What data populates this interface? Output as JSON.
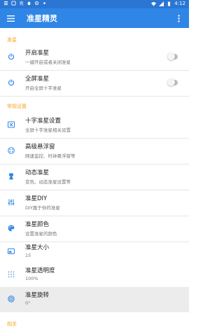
{
  "statusbar": {
    "time": "4:12"
  },
  "appbar": {
    "title": "准星精灵"
  },
  "colors": {
    "primary": "#2f86e6",
    "statusbar": "#2a76d2",
    "section": "#f5a623",
    "icon": "#2f86e6"
  },
  "sections": {
    "crosshair": "准星",
    "general": "常规设置",
    "related": "相关"
  },
  "rows": [
    {
      "label": "开启准星",
      "sub": "一键开启或者关闭准星",
      "icon": "power-icon",
      "toggle": true
    },
    {
      "label": "全屏准星",
      "sub": "开启全屏十字准星",
      "icon": "power-icon",
      "toggle": true
    },
    {
      "label": "十字准星设置",
      "sub": "全屏十字准星相关设置",
      "icon": "crosshair-box-icon"
    },
    {
      "label": "高级悬浮窗",
      "sub": "网速监控、时钟悬浮窗等",
      "icon": "dots-circle-icon"
    },
    {
      "label": "动态准星",
      "sub": "变色、动态准星设置等",
      "icon": "gamepad-icon"
    },
    {
      "label": "准星DIY",
      "sub": "DIY属于你的准星",
      "icon": "equalizer-icon"
    },
    {
      "label": "准星颜色",
      "sub": "设置准星的颜色",
      "icon": "palette-icon"
    },
    {
      "label": "准星大小",
      "sub": "15",
      "icon": "size-icon"
    },
    {
      "label": "准星透明度",
      "sub": "100%",
      "icon": "dotgrid-icon"
    },
    {
      "label": "准星旋转",
      "sub": "0°",
      "icon": "rotate-icon"
    }
  ]
}
